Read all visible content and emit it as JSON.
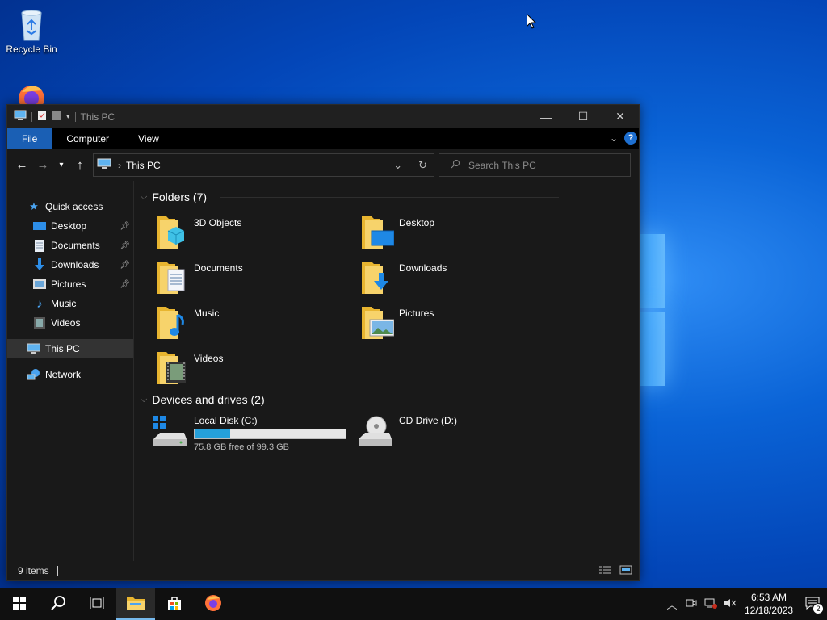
{
  "desktop": {
    "icons": [
      {
        "label": "Recycle Bin",
        "icon": "recycle-bin-icon"
      },
      {
        "label": "",
        "icon": "firefox-icon"
      }
    ]
  },
  "window": {
    "title": "This PC",
    "ribbon": {
      "tabs": [
        "File",
        "Computer",
        "View"
      ]
    },
    "address": {
      "path": "This PC"
    },
    "search": {
      "placeholder": "Search This PC"
    },
    "nav": {
      "quick_access": "Quick access",
      "quick_items": [
        {
          "label": "Desktop",
          "icon": "desktop-icon",
          "pinned": true
        },
        {
          "label": "Documents",
          "icon": "documents-icon",
          "pinned": true
        },
        {
          "label": "Downloads",
          "icon": "downloads-icon",
          "pinned": true
        },
        {
          "label": "Pictures",
          "icon": "pictures-icon",
          "pinned": true
        },
        {
          "label": "Music",
          "icon": "music-icon",
          "pinned": false
        },
        {
          "label": "Videos",
          "icon": "videos-icon",
          "pinned": false
        }
      ],
      "this_pc": "This PC",
      "network": "Network"
    },
    "folders_group": {
      "heading": "Folders (7)",
      "items": [
        "3D Objects",
        "Desktop",
        "Documents",
        "Downloads",
        "Music",
        "Pictures",
        "Videos"
      ]
    },
    "drives_group": {
      "heading": "Devices and drives (2)",
      "local_disk": {
        "label": "Local Disk (C:)",
        "free_text": "75.8 GB free of 99.3 GB",
        "used_fraction": 0.237
      },
      "cd_drive": {
        "label": "CD Drive (D:)"
      }
    },
    "status": {
      "count": "9 items"
    }
  },
  "taskbar": {
    "clock": {
      "time": "6:53 AM",
      "date": "12/18/2023"
    },
    "notification_count": "2"
  },
  "colors": {
    "accent": "#1a5fb4",
    "progress": "#26a0da",
    "folder": "#f5c842"
  }
}
